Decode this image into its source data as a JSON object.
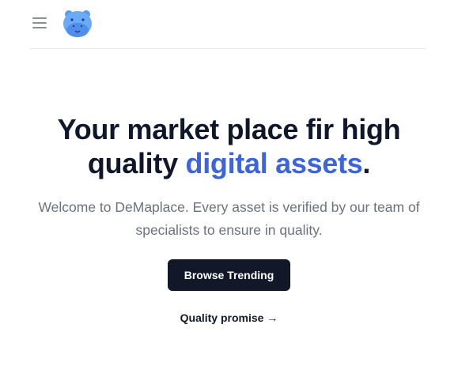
{
  "header": {
    "menu_icon": "hamburger-menu-icon",
    "logo_icon": "hippo-mascot-logo"
  },
  "hero": {
    "headline_main": "Your market place fir high quality ",
    "headline_accent": "digital assets",
    "headline_end": ".",
    "subtitle": "Welcome to DeMaplace. Every asset is verified by our team of specialists to ensure in quality.",
    "cta_label": "Browse Trending",
    "link_label": "Quality promise →"
  },
  "colors": {
    "accent": "#3d63dd",
    "button_bg": "#121828",
    "muted_text": "#6b7280",
    "logo_blue": "#60a5fa"
  }
}
